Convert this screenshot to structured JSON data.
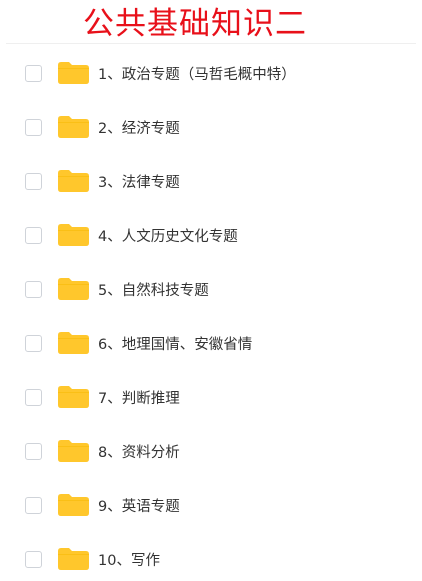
{
  "title": "公共基础知识二",
  "colors": {
    "title": "#e8101a",
    "folder": "#ffc72c",
    "folder_tab": "#f5b800",
    "checkbox_border": "#cfd3d9",
    "text": "#333333"
  },
  "icons": {
    "checkbox": "checkbox-icon",
    "folder": "folder-icon"
  },
  "items": [
    {
      "label": "1、政治专题（马哲毛概中特）"
    },
    {
      "label": "2、经济专题"
    },
    {
      "label": "3、法律专题"
    },
    {
      "label": "4、人文历史文化专题"
    },
    {
      "label": "5、自然科技专题"
    },
    {
      "label": "6、地理国情、安徽省情"
    },
    {
      "label": "7、判断推理"
    },
    {
      "label": "8、资料分析"
    },
    {
      "label": "9、英语专题"
    },
    {
      "label": "10、写作"
    }
  ]
}
